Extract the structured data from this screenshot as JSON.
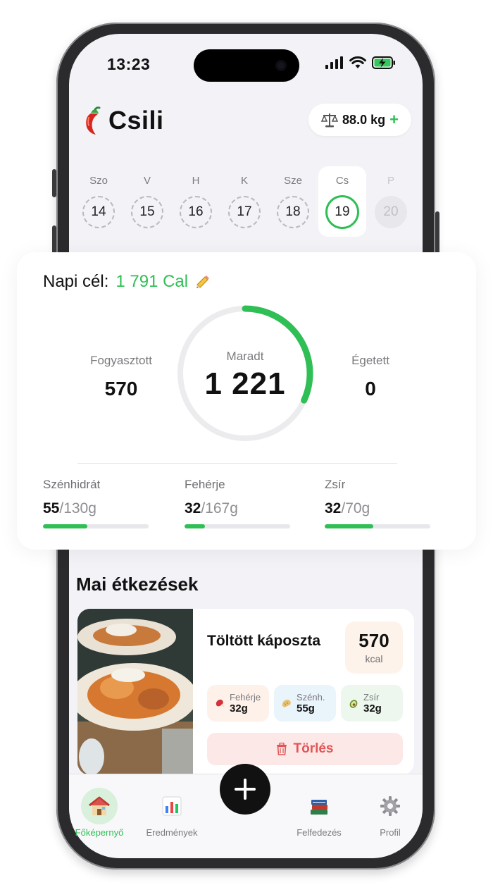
{
  "status_bar": {
    "time": "13:23"
  },
  "header": {
    "app_name": "Csili",
    "weight": "88.0 kg",
    "add_symbol": "+"
  },
  "days": [
    {
      "label": "Szo",
      "num": "14"
    },
    {
      "label": "V",
      "num": "15"
    },
    {
      "label": "H",
      "num": "16"
    },
    {
      "label": "K",
      "num": "17"
    },
    {
      "label": "Sze",
      "num": "18"
    },
    {
      "label": "Cs",
      "num": "19",
      "selected": true
    },
    {
      "label": "P",
      "num": "20",
      "future": true
    }
  ],
  "summary": {
    "goal_label": "Napi cél:",
    "goal_value": "1 791 Cal",
    "consumed_label": "Fogyasztott",
    "consumed_value": "570",
    "remaining_label": "Maradt",
    "remaining_value": "1 221",
    "burned_label": "Égetett",
    "burned_value": "0",
    "ring_progress": 0.318
  },
  "macros": [
    {
      "name": "Szénhidrát",
      "value": "55",
      "target": "/130g",
      "progress": 0.42
    },
    {
      "name": "Fehérje",
      "value": "32",
      "target": "/167g",
      "progress": 0.19
    },
    {
      "name": "Zsír",
      "value": "32",
      "target": "/70g",
      "progress": 0.46
    }
  ],
  "meals": {
    "title": "Mai étkezések",
    "items": [
      {
        "name": "Töltött káposzta",
        "kcal": "570",
        "kcal_unit": "kcal",
        "chips": [
          {
            "name": "Fehérje",
            "value": "32g",
            "bg": "#fdf1ea"
          },
          {
            "name": "Szénh.",
            "value": "55g",
            "bg": "#e9f4fb"
          },
          {
            "name": "Zsír",
            "value": "32g",
            "bg": "#edf7ee"
          }
        ],
        "delete_label": "Törlés"
      }
    ]
  },
  "tabbar": {
    "home": "Főképernyő",
    "results": "Eredmények",
    "explore": "Felfedezés",
    "profile": "Profil"
  },
  "colors": {
    "accent": "#2fbf55",
    "danger": "#e25555",
    "background": "#f2f2f7"
  }
}
